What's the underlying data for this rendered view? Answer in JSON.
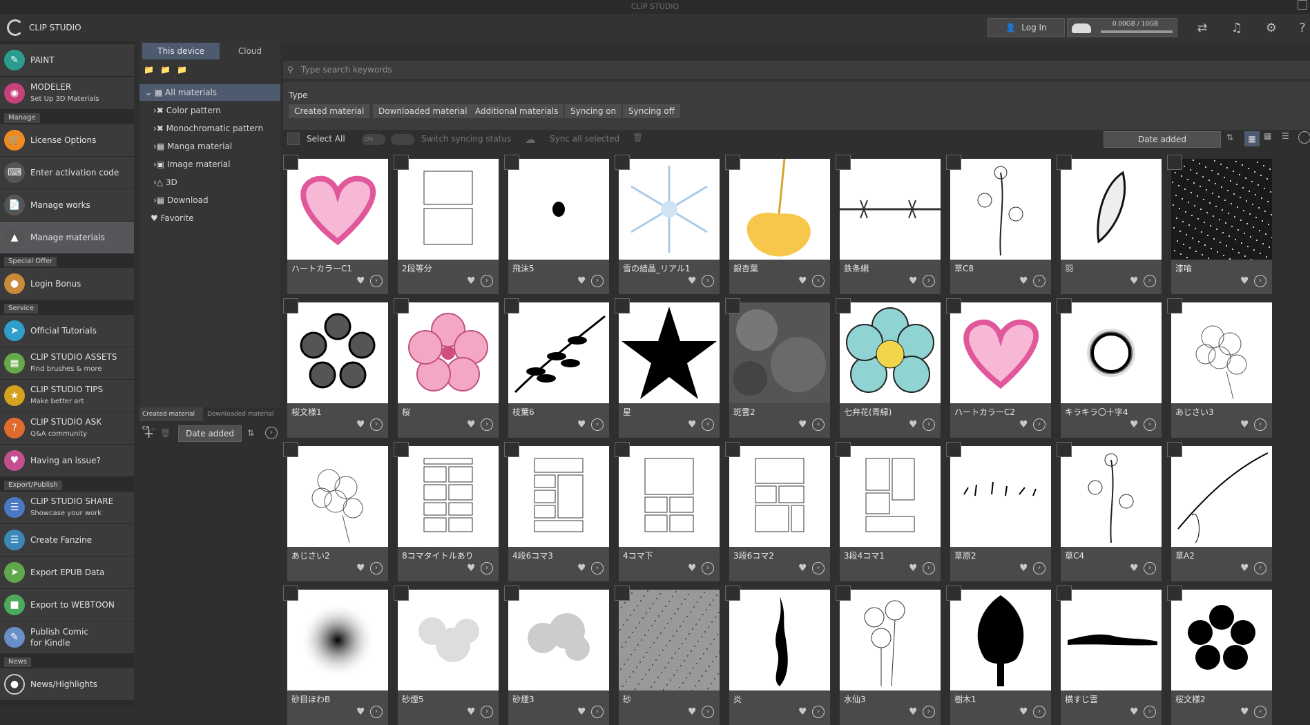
{
  "window": {
    "title": "CLIP STUDIO"
  },
  "header": {
    "brand": "CLIP STUDIO",
    "login": "Log In",
    "storage": "0.00GB / 10GB"
  },
  "sidebar": {
    "paint": "PAINT",
    "modeler": "MODELER",
    "modeler_sub": "Set Up 3D Materials",
    "manage_head": "Manage",
    "license": "License Options",
    "activation": "Enter activation code",
    "manage_works": "Manage works",
    "manage_materials": "Manage materials",
    "special_head": "Special Offer",
    "login_bonus": "Login Bonus",
    "service_head": "Service",
    "tutorials": "Official Tutorials",
    "assets": "CLIP STUDIO ASSETS",
    "assets_sub": "Find brushes & more",
    "tips": "CLIP STUDIO TIPS",
    "tips_sub": "Make better art",
    "ask": "CLIP STUDIO ASK",
    "ask_sub": "Q&A community",
    "issue": "Having an issue?",
    "export_head": "Export/Publish",
    "share": "CLIP STUDIO SHARE",
    "share_sub": "Showcase your work",
    "fanzine": "Create Fanzine",
    "epub": "Export EPUB Data",
    "webtoon": "Export to WEBTOON",
    "kindle": "Publish Comic",
    "kindle_sub": "for Kindle",
    "news_head": "News",
    "news": "News/Highlights"
  },
  "tree": {
    "tab_device": "This device",
    "tab_cloud": "Cloud",
    "all": "All materials",
    "color": "Color pattern",
    "mono": "Monochromatic pattern",
    "manga": "Manga material",
    "image": "Image material",
    "three_d": "3D",
    "download": "Download",
    "favorite": "Favorite",
    "panel_tab1": "Created material ca...",
    "panel_tab2": "Downloaded material ca...",
    "panel_sort": "Date added"
  },
  "main": {
    "search_placeholder": "Type search keywords",
    "type_label": "Type",
    "chips": [
      "Created material",
      "Downloaded material",
      "Additional materials",
      "Syncing on",
      "Syncing off"
    ],
    "select_all": "Select All",
    "switch_sync": "Switch syncing status",
    "sync_all": "Sync all selected",
    "sort": "Date added",
    "toggle_on": "ON"
  },
  "materials": [
    {
      "name": "ハートカラーC1",
      "kind": "heart"
    },
    {
      "name": "2段等分",
      "kind": "panels2"
    },
    {
      "name": "飛沫5",
      "kind": "drop"
    },
    {
      "name": "雪の結晶_リアル1",
      "kind": "snow"
    },
    {
      "name": "銀杏葉",
      "kind": "ginkgo"
    },
    {
      "name": "鉄条網",
      "kind": "wire"
    },
    {
      "name": "草C8",
      "kind": "flowerline"
    },
    {
      "name": "羽",
      "kind": "feather"
    },
    {
      "name": "漆喰",
      "kind": "noise"
    },
    {
      "name": "桜文様1",
      "kind": "sakura"
    },
    {
      "name": "桜",
      "kind": "pinkflower"
    },
    {
      "name": "枝葉6",
      "kind": "branch"
    },
    {
      "name": "星",
      "kind": "star"
    },
    {
      "name": "斑雲2",
      "kind": "cloudtex"
    },
    {
      "name": "七弁花(青緑)",
      "kind": "blueflower"
    },
    {
      "name": "ハートカラーC2",
      "kind": "heart"
    },
    {
      "name": "キラキラ〇十字4",
      "kind": "ring"
    },
    {
      "name": "あじさい3",
      "kind": "hydrangea"
    },
    {
      "name": "あじさい2",
      "kind": "hydrangea"
    },
    {
      "name": "8コマタイトルあり",
      "kind": "panels8"
    },
    {
      "name": "4段6コマ3",
      "kind": "panels6"
    },
    {
      "name": "4コマ下",
      "kind": "panels4"
    },
    {
      "name": "3段6コマ2",
      "kind": "panels6b"
    },
    {
      "name": "3段4コマ1",
      "kind": "panels4b"
    },
    {
      "name": "草原2",
      "kind": "grass"
    },
    {
      "name": "草C4",
      "kind": "flowerline"
    },
    {
      "name": "草A2",
      "kind": "grassline"
    },
    {
      "name": "砂目ほわB",
      "kind": "dots"
    },
    {
      "name": "砂煙5",
      "kind": "smoke"
    },
    {
      "name": "砂煙3",
      "kind": "smoke2"
    },
    {
      "name": "砂",
      "kind": "sand"
    },
    {
      "name": "炎",
      "kind": "flame"
    },
    {
      "name": "水仙3",
      "kind": "daffodil"
    },
    {
      "name": "樹木1",
      "kind": "tree"
    },
    {
      "name": "横すじ雲",
      "kind": "cloudline"
    },
    {
      "name": "桜文様2",
      "kind": "sakura2"
    }
  ]
}
